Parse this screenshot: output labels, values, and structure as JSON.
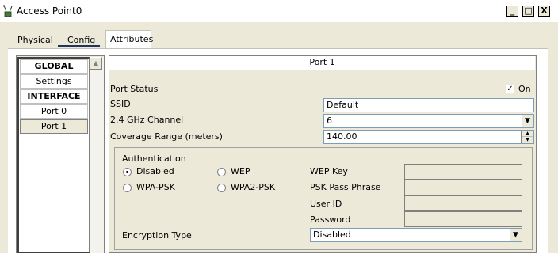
{
  "window": {
    "title": "Access Point0",
    "minimize_label": "_",
    "maximize_label": "□",
    "close_label": "X"
  },
  "tabs": [
    {
      "label": "Physical"
    },
    {
      "label": "Config"
    },
    {
      "label": "Attributes"
    }
  ],
  "active_tab": "Config",
  "sidebar": {
    "items": [
      {
        "label": "GLOBAL"
      },
      {
        "label": "Settings"
      },
      {
        "label": "INTERFACE"
      },
      {
        "label": "Port 0"
      },
      {
        "label": "Port 1"
      }
    ],
    "selected": "Port 1"
  },
  "panel": {
    "title": "Port 1",
    "port_status_label": "Port Status",
    "port_status_checked": true,
    "port_status_on_label": "On",
    "ssid_label": "SSID",
    "ssid_value": "Default",
    "channel_label": "2.4 GHz Channel",
    "channel_value": "6",
    "coverage_label": "Coverage Range (meters)",
    "coverage_value": "140.00"
  },
  "auth": {
    "title": "Authentication",
    "options": [
      {
        "label": "Disabled",
        "selected": true
      },
      {
        "label": "WEP",
        "selected": false
      },
      {
        "label": "WPA-PSK",
        "selected": false
      },
      {
        "label": "WPA2-PSK",
        "selected": false
      }
    ],
    "wep_key_label": "WEP Key",
    "psk_label": "PSK Pass Phrase",
    "user_id_label": "User ID",
    "password_label": "Password",
    "encryption_label": "Encryption Type",
    "encryption_value": "Disabled"
  },
  "colors": {
    "window_bg": "#ece9d8",
    "tab_underline": "#1e3560",
    "input_border": "#7f9db9"
  }
}
